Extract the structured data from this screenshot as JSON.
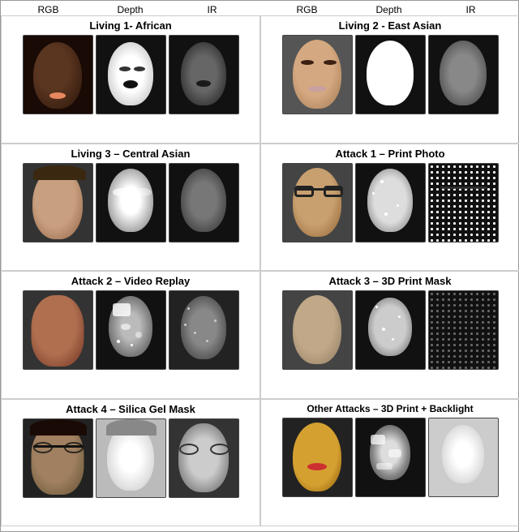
{
  "panels": [
    {
      "id": "living-african",
      "title": "Living 1- African",
      "col_labels": [
        "RGB",
        "Depth",
        "IR"
      ]
    },
    {
      "id": "living-east-asian",
      "title": "Living 2 - East Asian",
      "col_labels": [
        "RGB",
        "Depth",
        "IR"
      ]
    },
    {
      "id": "living-central-asian",
      "title": "Living 3 – Central Asian",
      "col_labels": [
        "RGB",
        "Depth",
        "IR"
      ]
    },
    {
      "id": "attack-print-photo",
      "title": "Attack 1 – Print Photo",
      "col_labels": [
        "RGB",
        "Depth",
        "IR"
      ]
    },
    {
      "id": "attack-video-replay",
      "title": "Attack 2 – Video Replay",
      "col_labels": [
        "RGB",
        "Depth",
        "IR"
      ]
    },
    {
      "id": "attack-3d-print-mask",
      "title": "Attack 3 – 3D Print Mask",
      "col_labels": [
        "RGB",
        "Depth",
        "IR"
      ]
    },
    {
      "id": "attack-silica-gel",
      "title": "Attack 4 – Silica Gel Mask",
      "col_labels": [
        "RGB",
        "Depth",
        "IR"
      ]
    },
    {
      "id": "other-attacks-backlight",
      "title": "Other Attacks – 3D Print + Backlight",
      "col_labels": [
        "RGB",
        "Depth",
        "IR"
      ]
    }
  ],
  "top_labels": {
    "left": {
      "rgb": "RGB",
      "depth": "Depth",
      "ir": "IR"
    },
    "right": {
      "rgb": "RGB",
      "depth": "Depth",
      "ir": "IR"
    }
  }
}
